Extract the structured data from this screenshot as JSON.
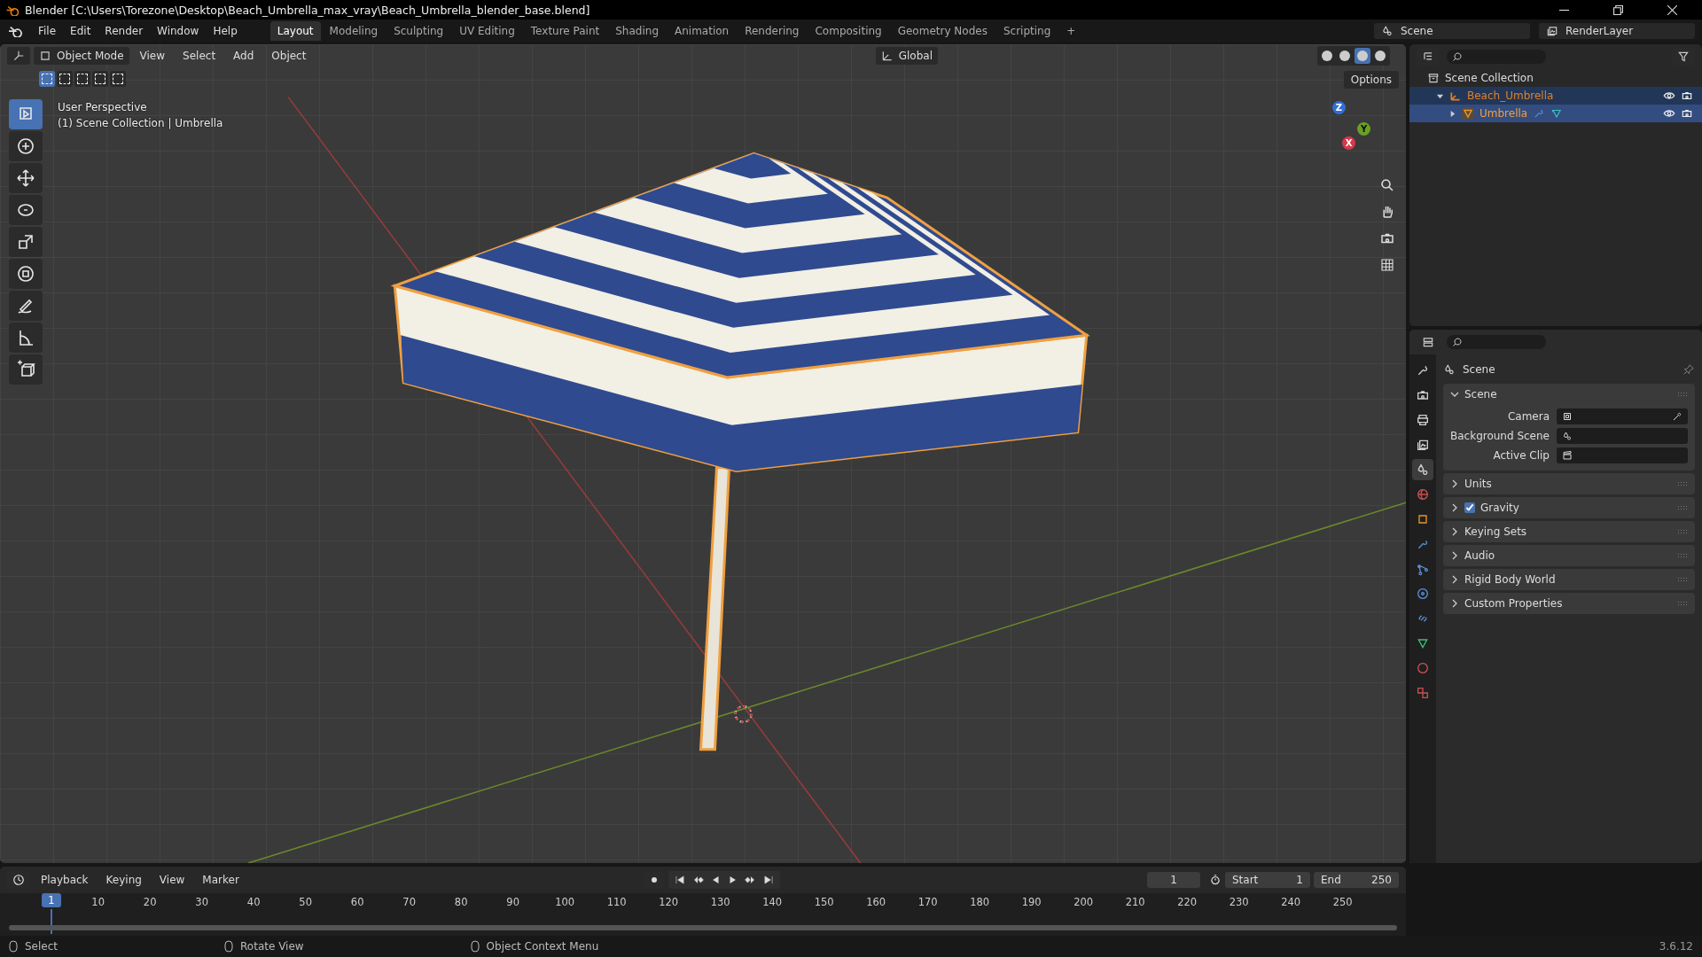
{
  "title_bar": {
    "title": "Blender [C:\\Users\\Torezone\\Desktop\\Beach_Umbrella_max_vray\\Beach_Umbrella_blender_base.blend]"
  },
  "menu": [
    "File",
    "Edit",
    "Render",
    "Window",
    "Help"
  ],
  "workspaces": [
    {
      "label": "Layout",
      "selected": true
    },
    {
      "label": "Modeling",
      "selected": false
    },
    {
      "label": "Sculpting",
      "selected": false
    },
    {
      "label": "UV Editing",
      "selected": false
    },
    {
      "label": "Texture Paint",
      "selected": false
    },
    {
      "label": "Shading",
      "selected": false
    },
    {
      "label": "Animation",
      "selected": false
    },
    {
      "label": "Rendering",
      "selected": false
    },
    {
      "label": "Compositing",
      "selected": false
    },
    {
      "label": "Geometry Nodes",
      "selected": false
    },
    {
      "label": "Scripting",
      "selected": false
    }
  ],
  "add_workspace": "+",
  "scene_selector": "Scene",
  "view_layer": "RenderLayer",
  "viewport": {
    "mode": "Object Mode",
    "menus": [
      "View",
      "Select",
      "Add",
      "Object"
    ],
    "orientation": "Global",
    "options": "Options",
    "select_modes": [
      {
        "selected": true
      },
      {
        "selected": false
      },
      {
        "selected": false
      },
      {
        "selected": false
      },
      {
        "selected": false
      }
    ],
    "shading_modes": [
      {
        "selected": false
      },
      {
        "selected": false
      },
      {
        "selected": true
      },
      {
        "selected": false
      }
    ],
    "overlay_text": [
      "User Perspective",
      "(1) Scene Collection | Umbrella"
    ],
    "tools": [
      {
        "kind": "select",
        "selected": true
      },
      {
        "kind": "cursor",
        "selected": false
      },
      {
        "kind": "move",
        "selected": false
      },
      {
        "kind": "rotate",
        "selected": false
      },
      {
        "kind": "scale",
        "selected": false
      },
      {
        "kind": "transform",
        "selected": false
      },
      {
        "kind": "annotate",
        "selected": false
      },
      {
        "kind": "measure",
        "selected": false
      },
      {
        "kind": "add_cube",
        "selected": false
      }
    ],
    "gizmo_axes": [
      "Z",
      "Y",
      "X"
    ]
  },
  "outliner": {
    "root": "Scene Collection",
    "items": [
      {
        "label": "Beach_Umbrella",
        "kind": "empty",
        "selected": true,
        "expanded": true,
        "children": [
          {
            "label": "Umbrella",
            "kind": "mesh",
            "selected": true,
            "expanded": false
          }
        ]
      }
    ]
  },
  "properties": {
    "header": "Scene",
    "tabs": [
      {
        "kind": "tool",
        "selected": false
      },
      {
        "kind": "render",
        "selected": false
      },
      {
        "kind": "output",
        "selected": false
      },
      {
        "kind": "view_layer",
        "selected": false
      },
      {
        "kind": "scene",
        "selected": true
      },
      {
        "kind": "world",
        "selected": false
      },
      {
        "kind": "object",
        "selected": false
      },
      {
        "kind": "modifiers",
        "selected": false
      },
      {
        "kind": "particles",
        "selected": false
      },
      {
        "kind": "physics",
        "selected": false
      },
      {
        "kind": "constraints",
        "selected": false
      },
      {
        "kind": "data",
        "selected": false
      },
      {
        "kind": "material",
        "selected": false
      },
      {
        "kind": "texture",
        "selected": false
      }
    ],
    "panels": [
      {
        "label": "Scene",
        "expanded": true,
        "fields": [
          {
            "label": "Camera",
            "kind": "camera"
          },
          {
            "label": "Background Scene",
            "kind": "scene"
          },
          {
            "label": "Active Clip",
            "kind": "clip"
          }
        ]
      },
      {
        "label": "Units",
        "expanded": false
      },
      {
        "label": "Gravity",
        "expanded": false,
        "checked": true
      },
      {
        "label": "Keying Sets",
        "expanded": false
      },
      {
        "label": "Audio",
        "expanded": false
      },
      {
        "label": "Rigid Body World",
        "expanded": false
      },
      {
        "label": "Custom Properties",
        "expanded": false
      }
    ]
  },
  "timeline": {
    "menus": [
      "Playback",
      "Keying",
      "View",
      "Marker"
    ],
    "current_frame": "1",
    "start_label": "Start",
    "start": "1",
    "end_label": "End",
    "end": "250",
    "playhead": "1",
    "ticks": [
      "10",
      "20",
      "30",
      "40",
      "50",
      "60",
      "70",
      "80",
      "90",
      "100",
      "110",
      "120",
      "130",
      "140",
      "150",
      "160",
      "170",
      "180",
      "190",
      "200",
      "210",
      "220",
      "230",
      "240",
      "250"
    ]
  },
  "status_bar": {
    "hints": [
      "Select",
      "Rotate View",
      "Object Context Menu"
    ],
    "version": "3.6.12"
  }
}
